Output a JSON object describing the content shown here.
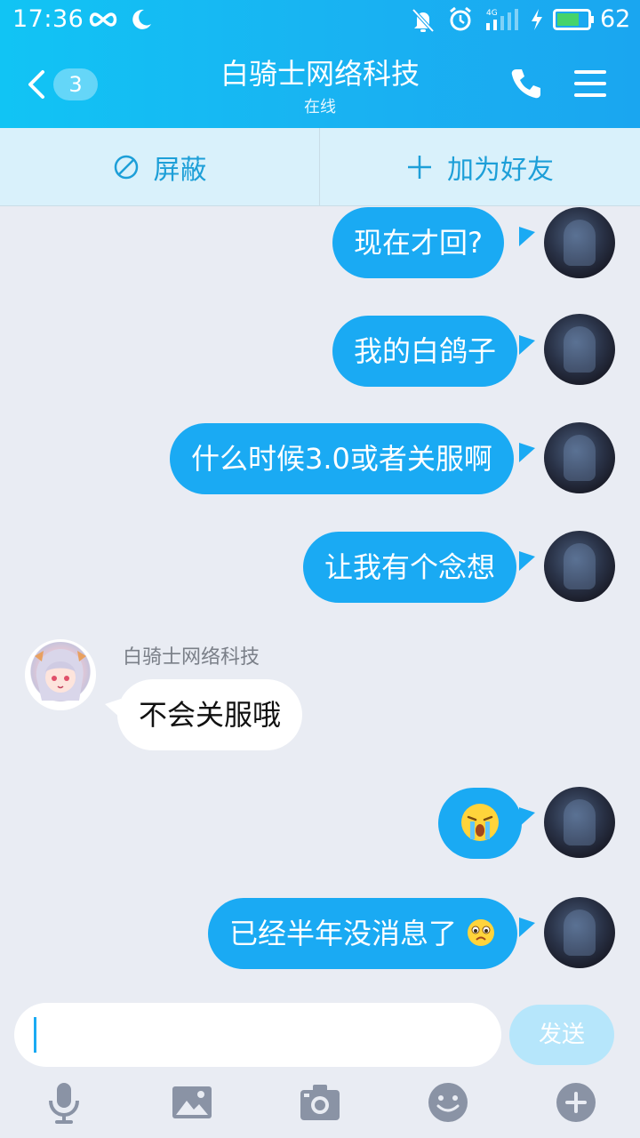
{
  "status_bar": {
    "time": "17:36",
    "battery_level": "62",
    "network": "4G"
  },
  "header": {
    "back_label": "<",
    "unread_count": "3",
    "title": "白骑士网络科技",
    "status": "在线",
    "icons": [
      "phone-icon",
      "menu-icon"
    ]
  },
  "actions": {
    "block_label": "屏蔽",
    "add_friend_label": "加为好友"
  },
  "messages": [
    {
      "sender": "me",
      "text": "现在才回?"
    },
    {
      "sender": "me",
      "text": "我的白鸽子"
    },
    {
      "sender": "me",
      "text": "什么时候3.0或者关服啊"
    },
    {
      "sender": "me",
      "text": "让我有个念想"
    },
    {
      "sender": "them",
      "name": "白骑士网络科技",
      "text": "不会关服哦"
    },
    {
      "sender": "me",
      "text": "",
      "emoji": "crying-emoji"
    },
    {
      "sender": "me",
      "text": "已经半年没消息了",
      "emoji": "sad-emoji"
    }
  ],
  "input": {
    "placeholder": "",
    "send_label": "发送"
  },
  "toolbar": [
    "microphone-icon",
    "image-icon",
    "camera-icon",
    "emoticon-icon",
    "plus-circle-icon"
  ],
  "colors": {
    "header": "#19b2f2",
    "bubble_me": "#1aaaf3",
    "bubble_them": "#ffffff",
    "background": "#e9ecf3",
    "action_bar": "#d9f1fb"
  }
}
